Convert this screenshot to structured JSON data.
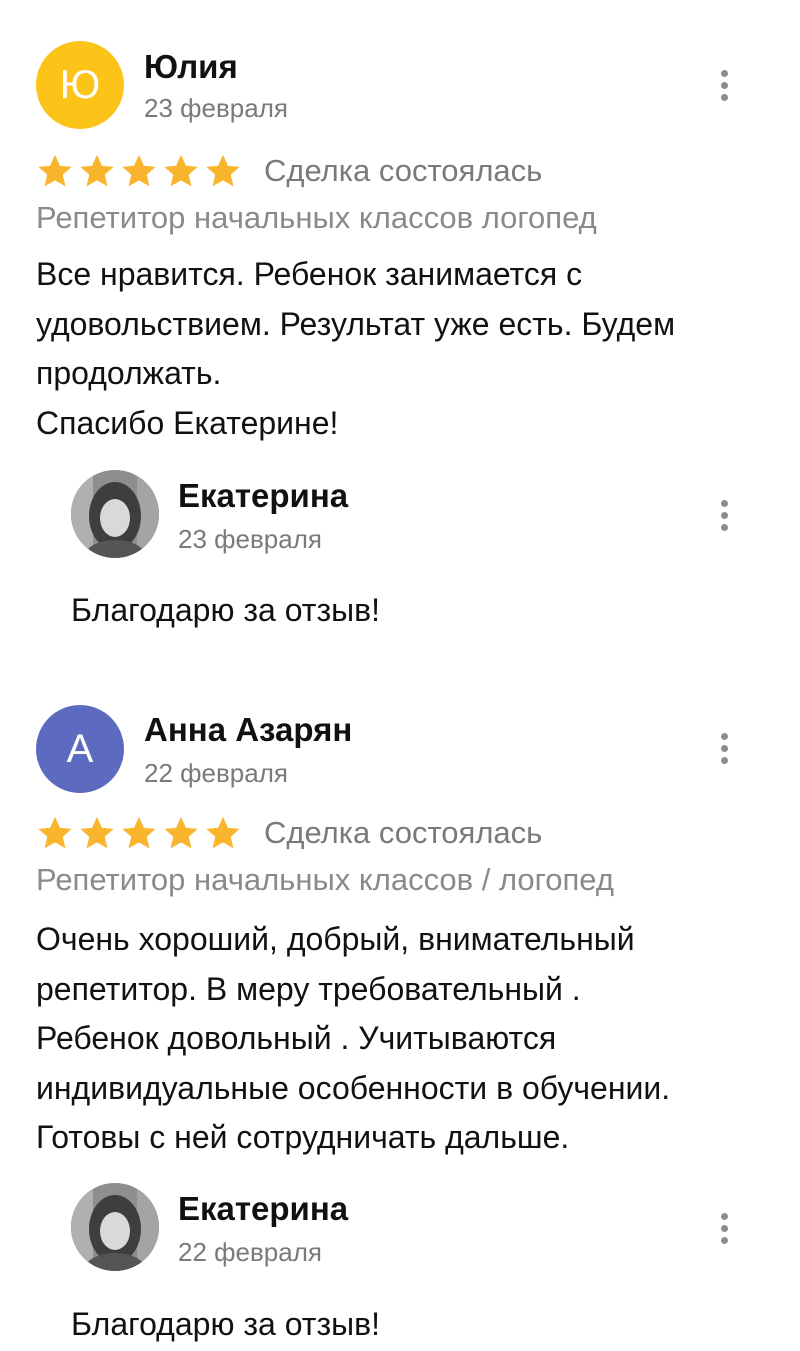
{
  "reviews": [
    {
      "avatar_letter": "Ю",
      "avatar_color": "#FCC419",
      "author": "Юлия",
      "date": "23 февраля",
      "rating": 5,
      "deal_status": "Сделка состоялась",
      "category": "Репетитор начальных классов логопед",
      "text_lines": [
        "Все нравится. Ребенок занимается с",
        "удовольствием. Результат уже есть. Будем",
        "продолжать.",
        "Спасибо Екатерине!"
      ],
      "reply": {
        "author": "Екатерина",
        "date": "23 февраля",
        "text": "Благодарю за отзыв!"
      }
    },
    {
      "avatar_letter": "А",
      "avatar_color": "#5C6BC0",
      "author": "Анна Азарян",
      "date": "22 февраля",
      "rating": 5,
      "deal_status": "Сделка состоялась",
      "category": "Репетитор начальных классов / логопед",
      "text_lines": [
        "Очень хороший, добрый, внимательный",
        "репетитор. В меру требовательный .",
        "Ребенок довольный . Учитываются",
        "индивидуальные особенности  в обучении.",
        "Готовы с ней сотрудничать дальше."
      ],
      "reply": {
        "author": "Екатерина",
        "date": "22 февраля",
        "text": "Благодарю за отзыв!"
      }
    }
  ],
  "colors": {
    "star": "#F9B52E",
    "secondary_text": "#7A7A7A"
  },
  "icons": {
    "more": "more-vertical-icon",
    "star": "star-icon"
  }
}
